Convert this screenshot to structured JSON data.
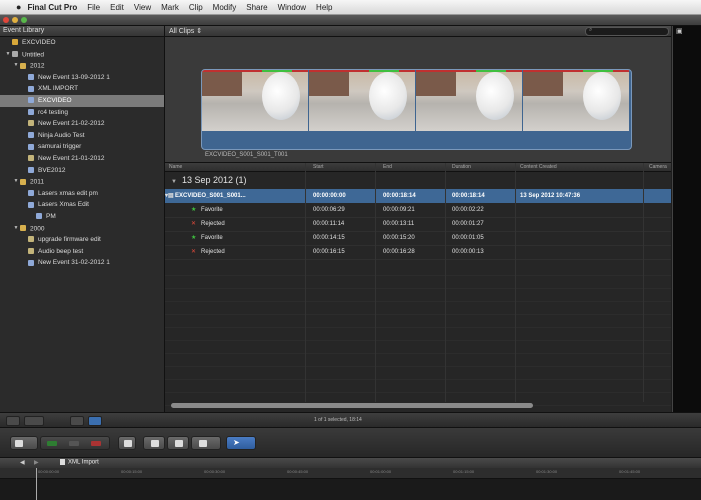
{
  "menubar": {
    "app": "Final Cut Pro",
    "items": [
      "File",
      "Edit",
      "View",
      "Mark",
      "Clip",
      "Modify",
      "Share",
      "Window",
      "Help"
    ]
  },
  "library": {
    "header": "Event Library",
    "items": [
      {
        "label": "EXCVIDEO",
        "icon": "star-icon",
        "level": 0
      },
      {
        "label": "Untitled",
        "icon": "drive-icon",
        "level": 0
      },
      {
        "label": "2012",
        "icon": "folder-icon",
        "level": 1
      },
      {
        "label": "New Event 13-09-2012 1",
        "icon": "event-icon",
        "level": 2
      },
      {
        "label": "XML IMPORT",
        "icon": "event-icon",
        "level": 2
      },
      {
        "label": "EXCVIDEO",
        "icon": "event-icon",
        "level": 2,
        "selected": true
      },
      {
        "label": "rc4 testing",
        "icon": "event-icon",
        "level": 2
      },
      {
        "label": "New Event 21-02-2012",
        "icon": "event-icon",
        "level": 2
      },
      {
        "label": "Ninja Audio Test",
        "icon": "event-icon",
        "level": 2
      },
      {
        "label": "samurai trigger",
        "icon": "event-icon",
        "level": 2
      },
      {
        "label": "New Event 21-01-2012",
        "icon": "event-icon",
        "level": 2
      },
      {
        "label": "BVE2012",
        "icon": "event-icon",
        "level": 2
      },
      {
        "label": "2011",
        "icon": "folder-icon",
        "level": 1
      },
      {
        "label": "Lasers xmas edit pm",
        "icon": "event-icon",
        "level": 2
      },
      {
        "label": "Lasers Xmas Edit",
        "icon": "event-icon",
        "level": 2
      },
      {
        "label": "PM",
        "icon": "event-icon",
        "level": 3
      },
      {
        "label": "2000",
        "icon": "folder-icon",
        "level": 1
      },
      {
        "label": "upgrade firmware edit",
        "icon": "event-icon",
        "level": 2
      },
      {
        "label": "Audio beep test",
        "icon": "event-icon",
        "level": 2
      },
      {
        "label": "New Event 31-02-2012 1",
        "icon": "event-icon",
        "level": 2
      }
    ]
  },
  "browser": {
    "title": "All Clips",
    "clip_label": "EXCVIDEO_S001_S001_T001",
    "columns": [
      "Name",
      "Start",
      "End",
      "Duration",
      "Content Created",
      "Camera"
    ],
    "date_group": "13 Sep 2012  (1)",
    "rows": [
      {
        "name": "EXCVIDEO_S001_S001...",
        "start": "00:00:00:00",
        "end": "00:00:18:14",
        "duration": "00:00:18:14",
        "created": "13 Sep 2012 10:47:36",
        "type": "clip",
        "selected": true
      },
      {
        "name": "Favorite",
        "start": "00:00:06:29",
        "end": "00:00:09:21",
        "duration": "00:00:02:22",
        "created": "",
        "type": "favorite"
      },
      {
        "name": "Rejected",
        "start": "00:00:11:14",
        "end": "00:00:13:11",
        "duration": "00:00:01:27",
        "created": "",
        "type": "rejected"
      },
      {
        "name": "Favorite",
        "start": "00:00:14:15",
        "end": "00:00:15:20",
        "duration": "00:00:01:05",
        "created": "",
        "type": "favorite"
      },
      {
        "name": "Rejected",
        "start": "00:00:16:15",
        "end": "00:00:16:28",
        "duration": "00:00:00:13",
        "created": "",
        "type": "rejected"
      }
    ],
    "status": "1 of 1 selected, 18:14"
  },
  "timeline": {
    "project": "XML Import",
    "ruler": [
      "00:00:00:00",
      "00:00:15:00",
      "00:00:30:00",
      "00:00:45:00",
      "00:01:00:00",
      "00:01:15:00",
      "00:01:30:00",
      "00:01:45:00",
      "00:02:00:00"
    ]
  },
  "colors": {
    "selection": "#3e6896",
    "favorite": "#3fbf3f",
    "rejected": "#e04a3a",
    "filmstrip": "#3f6590"
  }
}
